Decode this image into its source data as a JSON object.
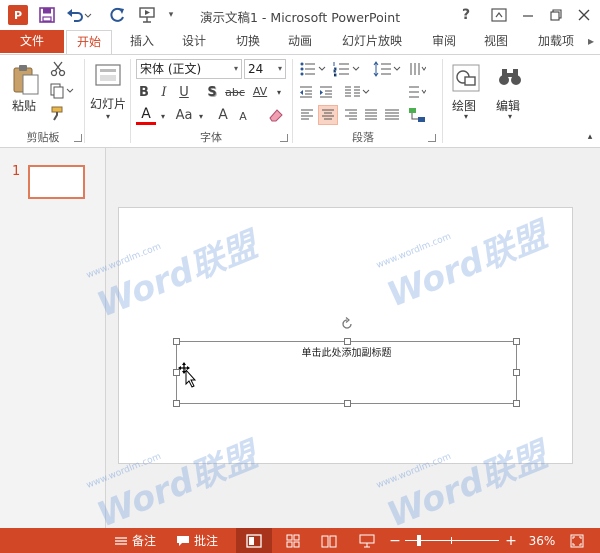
{
  "window": {
    "title": "演示文稿1 - Microsoft PowerPoint",
    "app_logo": "P",
    "help": "?"
  },
  "tabs": [
    {
      "label": "文件"
    },
    {
      "label": "开始"
    },
    {
      "label": "插入"
    },
    {
      "label": "设计"
    },
    {
      "label": "切换"
    },
    {
      "label": "动画"
    },
    {
      "label": "幻灯片放映"
    },
    {
      "label": "审阅"
    },
    {
      "label": "视图"
    },
    {
      "label": "加载项"
    }
  ],
  "ribbon": {
    "clipboard": {
      "paste_label": "粘贴",
      "group_label": "剪贴板"
    },
    "slides": {
      "slides_label": "幻灯片"
    },
    "font": {
      "font_name": "宋体 (正文)",
      "font_size": "24",
      "bold": "B",
      "italic": "I",
      "underline": "U",
      "shadow": "S",
      "strike": "abc",
      "spacing": "AV",
      "case": "Aa",
      "grow": "A",
      "shrink": "A",
      "color": "A",
      "group_label": "字体"
    },
    "paragraph": {
      "group_label": "段落"
    },
    "drawing": {
      "label": "绘图"
    },
    "editing": {
      "label": "编辑"
    }
  },
  "slide_panel": {
    "slide_number": "1"
  },
  "slide": {
    "subtitle_placeholder": "单击此处添加副标题"
  },
  "watermark": {
    "text": "Word联盟",
    "url": "www.wordlm.com"
  },
  "statusbar": {
    "notes_label": "备注",
    "comments_label": "批注",
    "zoom_minus": "−",
    "zoom_plus": "+",
    "zoom_percent": "36%",
    "zoom_level": 0.36
  },
  "colors": {
    "accent": "#d24726",
    "status_bar": "#d24726",
    "selected": "#f9d3c4"
  }
}
